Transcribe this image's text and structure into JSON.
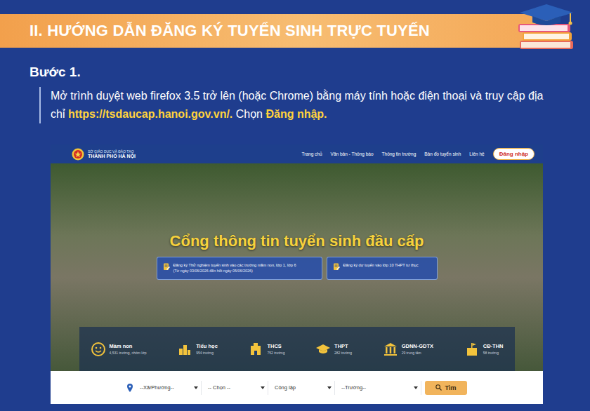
{
  "header": {
    "title": "II. HƯỚNG DẪN ĐĂNG KÝ TUYỂN SINH TRỰC TUYẾN"
  },
  "step": {
    "title": "Bước 1.",
    "text_parts": [
      {
        "text": "Mở trình duyệt web firefox 3.5 trở lên (hoặc Chrome) bằng máy tính hoặc điện thoại và truy cập địa chỉ ",
        "highlight": false
      },
      {
        "text": "https://tsdaucap.hanoi.gov.vn/.",
        "highlight": true
      },
      {
        "text": " Chọn ",
        "highlight": false
      },
      {
        "text": "Đăng nhập.",
        "highlight": true
      }
    ]
  },
  "site": {
    "logo_line1": "SỞ GIÁO DỤC VÀ ĐÀO TẠO",
    "logo_line2": "THÀNH PHỐ HÀ NỘI",
    "nav": [
      {
        "label": "Trang chủ"
      },
      {
        "label": "Văn bản - Thông báo"
      },
      {
        "label": "Thông tin trường"
      },
      {
        "label": "Bản đồ tuyển sinh"
      },
      {
        "label": "Liên hệ"
      }
    ],
    "login": "Đăng nhập",
    "hero_title": "Cổng thông tin tuyển sinh đầu cấp",
    "cards": [
      {
        "title": "Đăng ký Thử nghiệm tuyển sinh vào các trường mầm non, lớp 1, lớp 6",
        "note": "(Từ ngày 03/06/2026 đến hết ngày 05/06/2026)"
      },
      {
        "title": "Đăng ký dự tuyển vào lớp 10 THPT tư thục"
      }
    ],
    "levels": [
      {
        "name": "Mầm non",
        "count": "4,531 trường, nhóm lớp"
      },
      {
        "name": "Tiểu học",
        "count": "954 trường"
      },
      {
        "name": "THCS",
        "count": "752 trường"
      },
      {
        "name": "THPT",
        "count": "282 trường"
      },
      {
        "name": "GDNN-GDTX",
        "count": "29 trung tâm"
      },
      {
        "name": "CĐ-THN",
        "count": "58 trường"
      }
    ],
    "search": {
      "fields": [
        "--Xã/Phường--",
        "-- Chọn --",
        "Công lập",
        "--Trường--"
      ],
      "button": "Tìm"
    }
  }
}
